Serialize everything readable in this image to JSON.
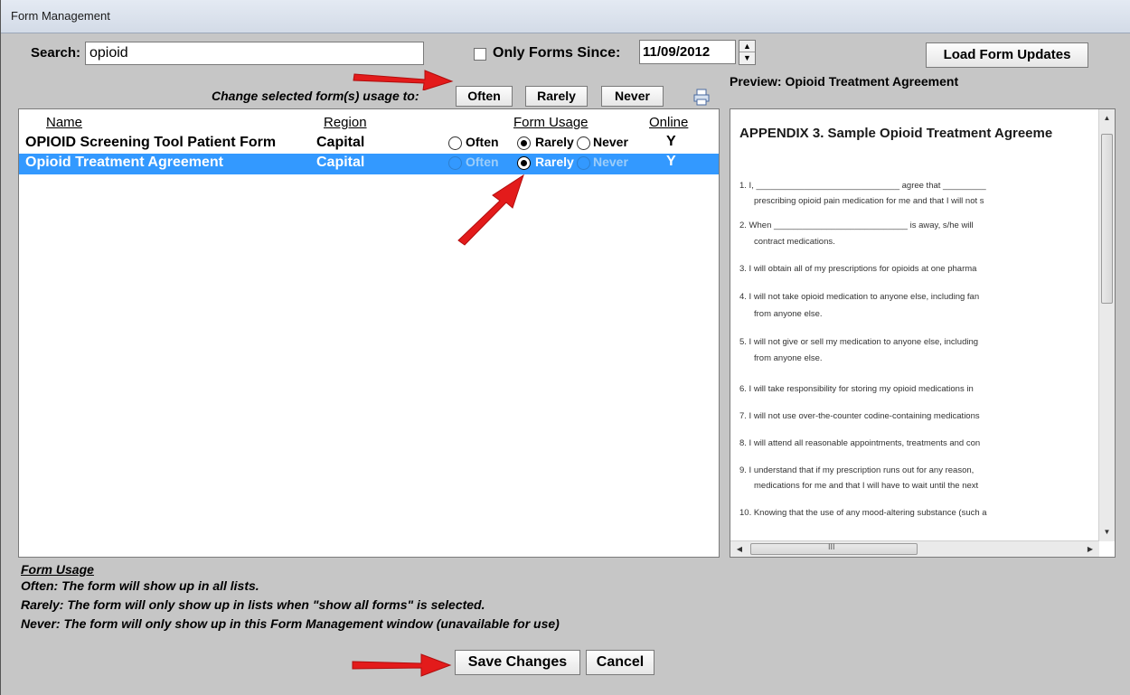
{
  "window": {
    "title": "Form Management"
  },
  "search": {
    "label": "Search:",
    "value": "opioid"
  },
  "filter": {
    "only_forms_since_label": "Only Forms Since:",
    "date_value": "11/09/2012",
    "checked": false
  },
  "toolbar": {
    "load_updates_label": "Load Form Updates"
  },
  "preview": {
    "label": "Preview: Opioid Treatment Agreement",
    "document_title": "APPENDIX 3. Sample Opioid Treatment Agreeme",
    "items": [
      "1.  I, ______________________________ agree that _________",
      "prescribing opioid pain medication for me and that I will not s",
      "2.  When ____________________________ is away, s/he will",
      "contract medications.",
      "3.  I will obtain all of my prescriptions for opioids at one pharma",
      "4.  I will not take opioid medication to anyone else, including fan",
      "from anyone else.",
      "5.  I will not give or sell my medication to anyone else, including",
      "from anyone else.",
      "6.  I will take responsibility for storing my opioid medications in",
      "7.  I will not use over-the-counter codine-containing medications",
      "8.  I will attend all reasonable appointments, treatments and con",
      "9.  I understand that if my prescription runs out for any reason,",
      "medications for me and that I will have to wait until the next",
      "10. Knowing that the use of any mood-altering substance (such a"
    ],
    "scroll_marker": "III"
  },
  "bulk_usage": {
    "label": "Change selected form(s) usage to:",
    "often_label": "Often",
    "rarely_label": "Rarely",
    "never_label": "Never"
  },
  "table": {
    "headers": {
      "name": "Name",
      "region": "Region",
      "usage": "Form Usage",
      "online": "Online"
    },
    "rows": [
      {
        "name": "OPIOID Screening Tool Patient Form",
        "region": "Capital",
        "often": "Often",
        "rarely": "Rarely",
        "never": "Never",
        "selected_usage": "Rarely",
        "online": "Y",
        "selected": false
      },
      {
        "name": "Opioid Treatment Agreement",
        "region": "Capital",
        "often": "Often",
        "rarely": "Rarely",
        "never": "Never",
        "selected_usage": "Rarely",
        "online": "Y",
        "selected": true
      }
    ]
  },
  "usage_help": {
    "title": "Form Usage",
    "often": "Often: The form will show up in all lists.",
    "rarely": "Rarely: The form will only show up in lists when \"show all forms\" is selected.",
    "never": "Never: The form will only show up in this Form Management window (unavailable for use)"
  },
  "footer": {
    "save_label": "Save Changes",
    "cancel_label": "Cancel"
  },
  "colors": {
    "selection": "#3399ff",
    "annotation_arrow": "#e31b1b",
    "window_bg": "#c6c6c6"
  },
  "icons": {
    "print": "printer-icon"
  }
}
